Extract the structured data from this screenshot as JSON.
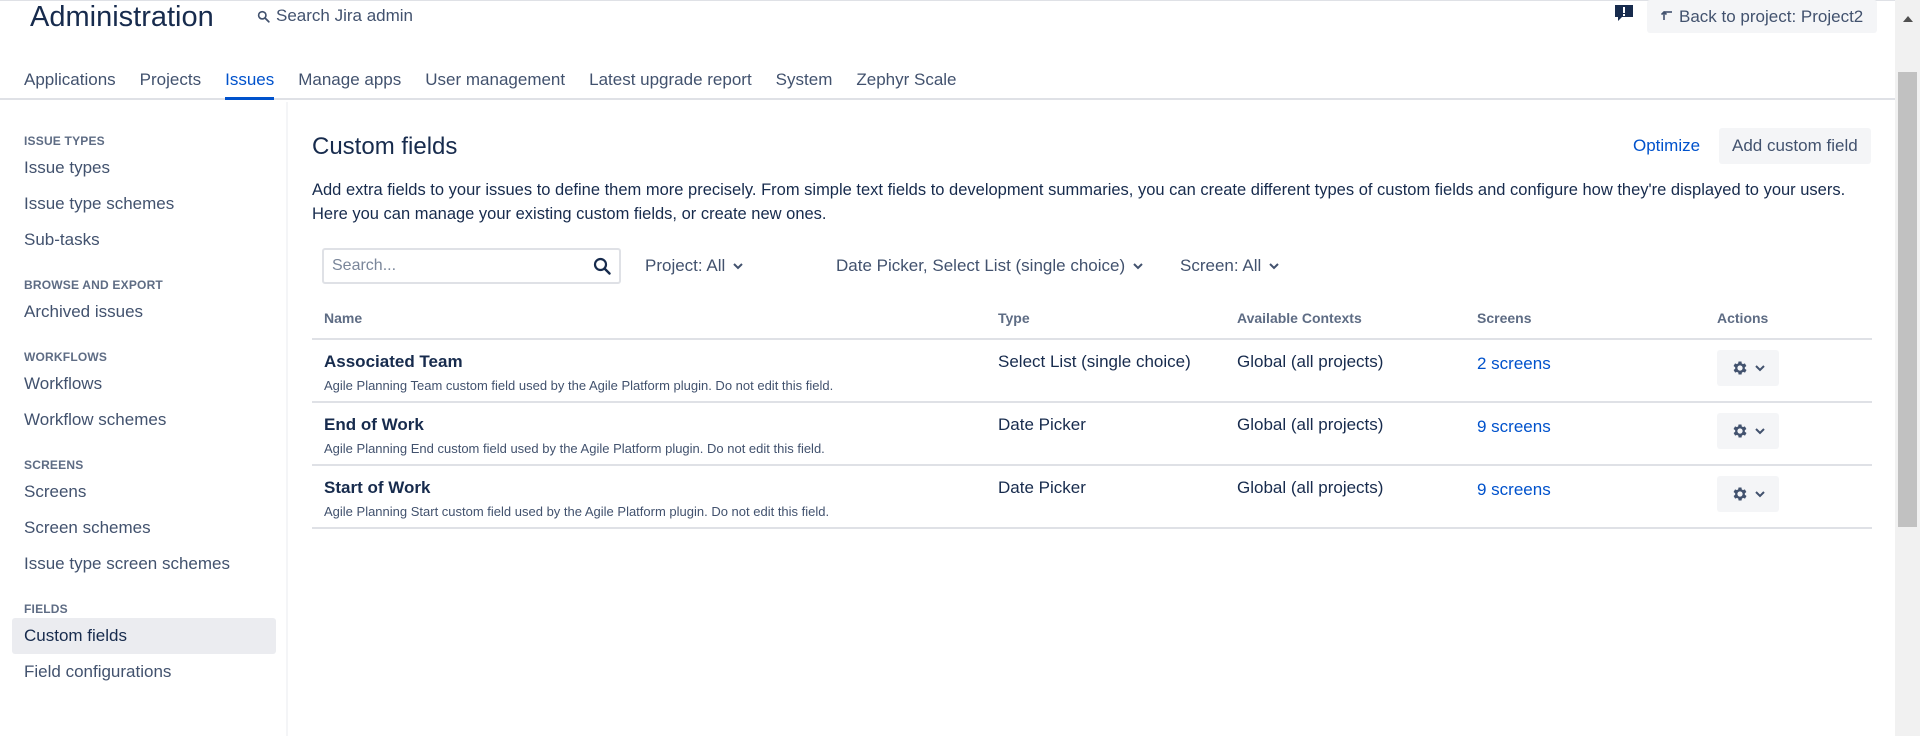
{
  "header": {
    "title": "Administration",
    "search_label": "Search Jira admin",
    "back_label": "Back to project: Project2"
  },
  "tabs": [
    {
      "label": "Applications"
    },
    {
      "label": "Projects"
    },
    {
      "label": "Issues",
      "active": true
    },
    {
      "label": "Manage apps"
    },
    {
      "label": "User management"
    },
    {
      "label": "Latest upgrade report"
    },
    {
      "label": "System"
    },
    {
      "label": "Zephyr Scale"
    }
  ],
  "sidebar": {
    "sections": [
      {
        "title": "ISSUE TYPES",
        "items": [
          "Issue types",
          "Issue type schemes",
          "Sub-tasks"
        ]
      },
      {
        "title": "BROWSE AND EXPORT",
        "items": [
          "Archived issues"
        ]
      },
      {
        "title": "WORKFLOWS",
        "items": [
          "Workflows",
          "Workflow schemes"
        ]
      },
      {
        "title": "SCREENS",
        "items": [
          "Screens",
          "Screen schemes",
          "Issue type screen schemes"
        ]
      },
      {
        "title": "FIELDS",
        "items": [
          "Custom fields",
          "Field configurations"
        ]
      }
    ],
    "active_item": "Custom fields"
  },
  "main": {
    "title": "Custom fields",
    "optimize_label": "Optimize",
    "add_label": "Add custom field",
    "description": "Add extra fields to your issues to define them more precisely. From simple text fields to development summaries, you can create different types of custom fields and configure how they're displayed to your users. Here you can manage your existing custom fields, or create new ones."
  },
  "filters": {
    "search_placeholder": "Search...",
    "project": "Project: All",
    "type": "Date Picker, Select List (single choice)",
    "screen": "Screen: All"
  },
  "table": {
    "headers": {
      "name": "Name",
      "type": "Type",
      "contexts": "Available Contexts",
      "screens": "Screens",
      "actions": "Actions"
    },
    "rows": [
      {
        "name": "Associated Team",
        "desc": "Agile Planning Team custom field used by the Agile Platform plugin. Do not edit this field.",
        "type": "Select List (single choice)",
        "contexts": "Global (all projects)",
        "screens": "2 screens"
      },
      {
        "name": "End of Work",
        "desc": "Agile Planning End custom field used by the Agile Platform plugin. Do not edit this field.",
        "type": "Date Picker",
        "contexts": "Global (all projects)",
        "screens": "9 screens"
      },
      {
        "name": "Start of Work",
        "desc": "Agile Planning Start custom field used by the Agile Platform plugin. Do not edit this field.",
        "type": "Date Picker",
        "contexts": "Global (all projects)",
        "screens": "9 screens"
      }
    ]
  },
  "colors": {
    "link": "#0052cc",
    "text": "#172b4d",
    "subtle": "#42526e",
    "button_bg": "#f4f5f7"
  },
  "icons": {
    "search": "search-icon",
    "feedback": "feedback-icon",
    "back": "back-arrow-icon",
    "chevron": "chevron-down-icon",
    "gear": "gear-icon"
  }
}
